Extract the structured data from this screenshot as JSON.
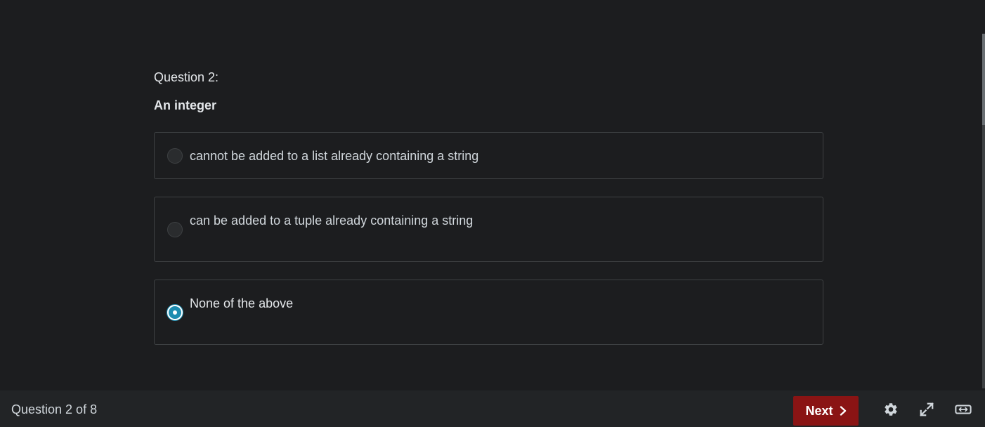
{
  "question": {
    "number_label": "Question 2:",
    "prompt": "An integer",
    "options": [
      {
        "label": "cannot be added to a list already containing a string",
        "selected": false
      },
      {
        "label": "can be added to a tuple already containing a string",
        "selected": false
      },
      {
        "label": "None of the above",
        "selected": true
      }
    ]
  },
  "footer": {
    "progress": "Question 2 of 8",
    "next_label": "Next",
    "icons": [
      "gear-icon",
      "expand-icon",
      "wide-screen-icon"
    ]
  },
  "colors": {
    "background": "#1c1d1f",
    "next_button": "#8a1414",
    "radio_selected": "#1c8cb0",
    "option_border": "#3e4143"
  }
}
